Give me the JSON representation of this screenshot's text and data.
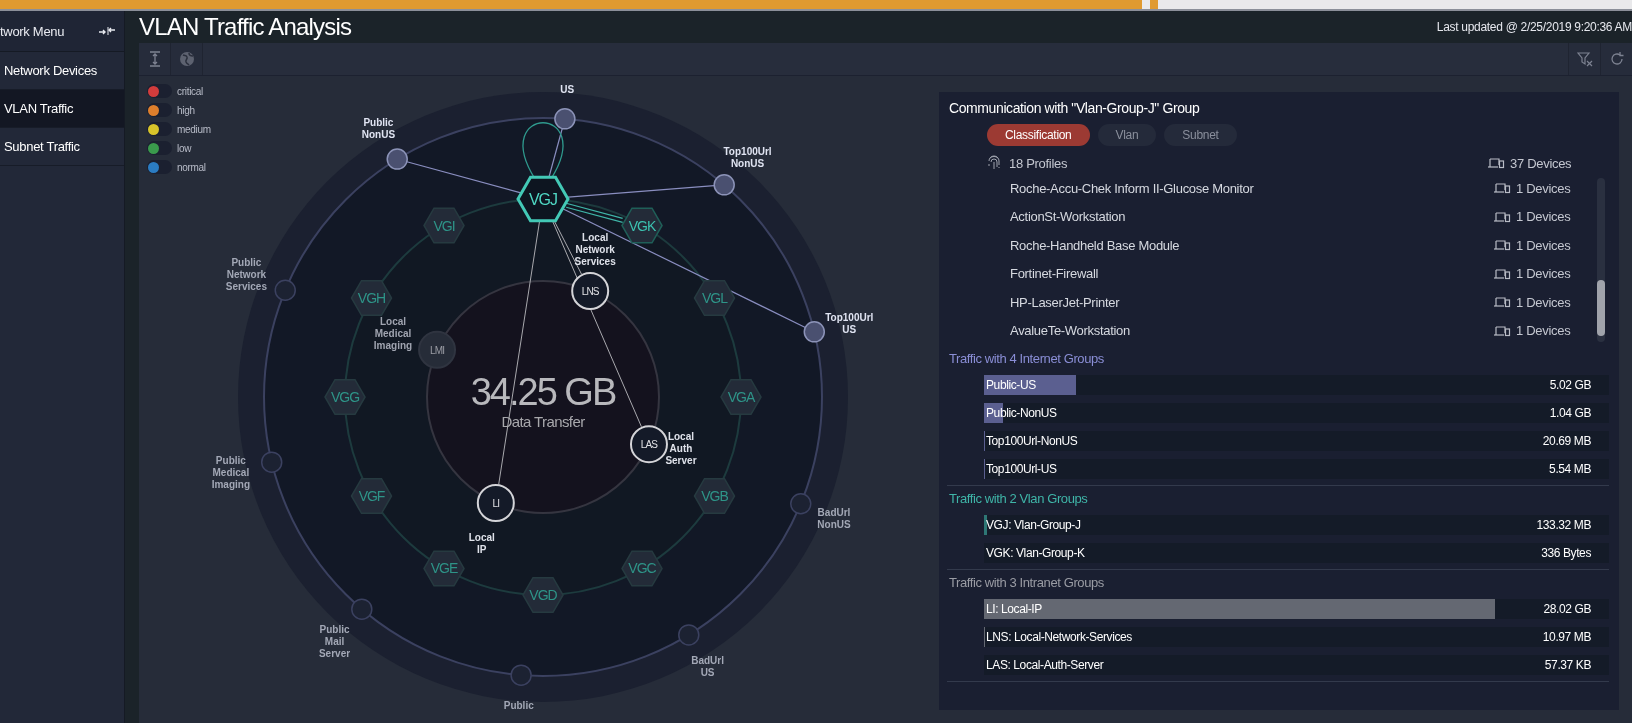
{
  "sidebar": {
    "header": "twork Menu",
    "items": [
      {
        "label": "Network Devices",
        "selected": false
      },
      {
        "label": "VLAN Traffic",
        "selected": true
      },
      {
        "label": "Subnet Traffic",
        "selected": false
      }
    ]
  },
  "page": {
    "title": "VLAN Traffic Analysis",
    "last_updated": "Last updated @ 2/25/2019 9:20:36 AM"
  },
  "legend": [
    {
      "label": "critical",
      "color": "#d23c3c"
    },
    {
      "label": "high",
      "color": "#de7f2c"
    },
    {
      "label": "medium",
      "color": "#d8c42a"
    },
    {
      "label": "low",
      "color": "#3a9a4c"
    },
    {
      "label": "normal",
      "color": "#2b7cc2"
    }
  ],
  "graph": {
    "total": "34.25 GB",
    "total_caption": "Data Transfer",
    "outer_nodes": [
      {
        "label": "US",
        "connected": true
      },
      {
        "label": "Public NonUS",
        "connected": true
      },
      {
        "label": "Top100Url NonUS",
        "connected": true
      },
      {
        "label": "Public Network Services",
        "connected": false
      },
      {
        "label": "Top100Url US",
        "connected": true
      },
      {
        "label": "Public Medical Imaging",
        "connected": false
      },
      {
        "label": "BadUrl NonUS",
        "connected": false
      },
      {
        "label": "Public Mail Server",
        "connected": false
      },
      {
        "label": "BadUrl US",
        "connected": false
      },
      {
        "label": "Public",
        "connected": false
      }
    ],
    "vlan_nodes": [
      {
        "label": "VGJ",
        "selected": true,
        "connected": false,
        "self_traffic": true
      },
      {
        "label": "VGK",
        "selected": false,
        "connected": true,
        "self_traffic": false
      },
      {
        "label": "VGL",
        "selected": false,
        "connected": false,
        "self_traffic": false
      },
      {
        "label": "VGA",
        "selected": false,
        "connected": false,
        "self_traffic": false
      },
      {
        "label": "VGB",
        "selected": false,
        "connected": false,
        "self_traffic": false
      },
      {
        "label": "VGC",
        "selected": false,
        "connected": false,
        "self_traffic": false
      },
      {
        "label": "VGD",
        "selected": false,
        "connected": false,
        "self_traffic": false
      },
      {
        "label": "VGE",
        "selected": false,
        "connected": false,
        "self_traffic": false
      },
      {
        "label": "VGF",
        "selected": false,
        "connected": false,
        "self_traffic": false
      },
      {
        "label": "VGG",
        "selected": false,
        "connected": false,
        "self_traffic": false
      },
      {
        "label": "VGH",
        "selected": false,
        "connected": false,
        "self_traffic": false
      },
      {
        "label": "VGI",
        "selected": false,
        "connected": false,
        "self_traffic": false
      }
    ],
    "inner_nodes": [
      {
        "code": "LNS",
        "label": "Local Network Services",
        "connected": true
      },
      {
        "code": "LAS",
        "label": "Local Auth Server",
        "connected": true
      },
      {
        "code": "LI",
        "label": "Local IP",
        "connected": true
      },
      {
        "code": "LMI",
        "label": "Local Medical Imaging",
        "connected": false
      }
    ]
  },
  "details": {
    "title": "Communication with \"Vlan-Group-J\" Group",
    "tabs": [
      {
        "label": "Classification",
        "selected": true
      },
      {
        "label": "Vlan",
        "selected": false
      },
      {
        "label": "Subnet",
        "selected": false
      }
    ],
    "profiles_count": "18 Profiles",
    "devices_count": "37 Devices",
    "profiles": [
      {
        "name": "Roche-Accu-Chek Inform II-Glucose Monitor",
        "devices": "1 Devices"
      },
      {
        "name": "ActionSt-Workstation",
        "devices": "1 Devices"
      },
      {
        "name": "Roche-Handheld Base Module",
        "devices": "1 Devices"
      },
      {
        "name": "Fortinet-Firewall",
        "devices": "1 Devices"
      },
      {
        "name": "HP-LaserJet-Printer",
        "devices": "1 Devices"
      },
      {
        "name": "AvalueTe-Workstation",
        "devices": "1 Devices"
      }
    ],
    "sections": [
      {
        "title": "Traffic with 4 Internet Groups",
        "color": "#8a8ed6",
        "rows": [
          {
            "name": "Public-US",
            "value": "5.02 GB",
            "level": 0.147
          },
          {
            "name": "Public-NonUS",
            "value": "1.04 GB",
            "level": 0.03
          },
          {
            "name": "Top100Url-NonUS",
            "value": "20.69 MB",
            "level": 0.0006
          },
          {
            "name": "Top100Url-US",
            "value": "5.54 MB",
            "level": 0.0002
          }
        ]
      },
      {
        "title": "Traffic with 2 Vlan Groups",
        "color": "#3fb5a8",
        "rows": [
          {
            "name": "VGJ: Vlan-Group-J",
            "value": "133.32 MB",
            "level": 0.004
          },
          {
            "name": "VGK: Vlan-Group-K",
            "value": "336 Bytes",
            "level": 0
          }
        ]
      },
      {
        "title": "Traffic with 3 Intranet Groups",
        "color": "#9a9ca4",
        "rows": [
          {
            "name": "LI: Local-IP",
            "value": "28.02 GB",
            "level": 0.818
          },
          {
            "name": "LNS: Local-Network-Services",
            "value": "10.97 MB",
            "level": 0.0003
          },
          {
            "name": "LAS: Local-Auth-Server",
            "value": "57.37 KB",
            "level": 2e-06
          }
        ]
      }
    ]
  }
}
